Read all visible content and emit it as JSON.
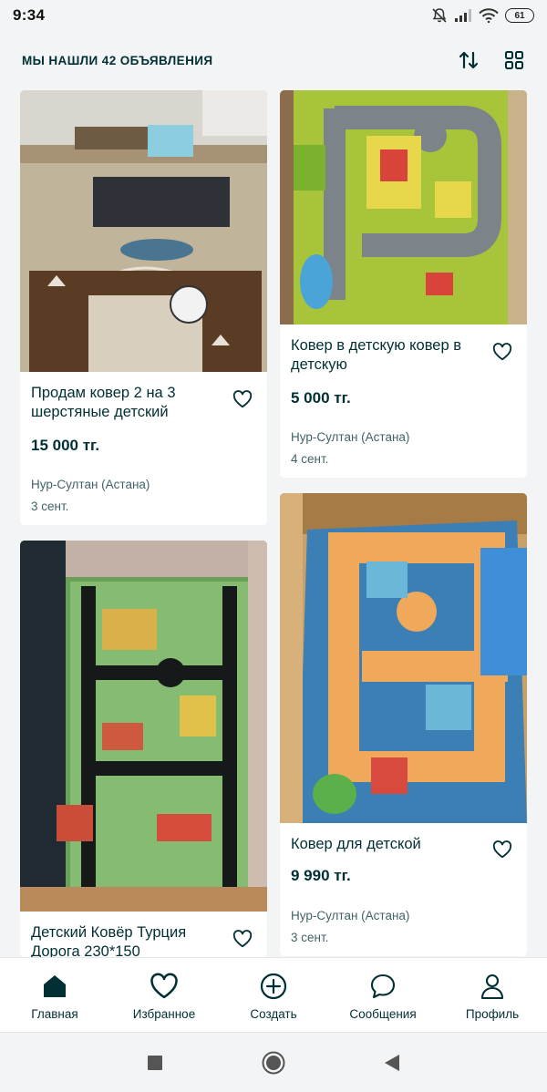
{
  "status_bar": {
    "time": "9:34",
    "battery": "61"
  },
  "header": {
    "results_title": "МЫ НАШЛИ 42 ОБЪЯВЛЕНИЯ"
  },
  "listings": [
    {
      "title": "Продам ковер 2 на 3 шерстяные детский",
      "price": "15 000 тг.",
      "location": "Нур-Султан (Астана)",
      "date": "3 сент."
    },
    {
      "title": "Ковер в детскую ковер в детскую",
      "price": "5 000 тг.",
      "location": "Нур-Султан (Астана)",
      "date": "4 сент."
    },
    {
      "title": "Детский Ковёр Турция Дорога 230*150",
      "price": "",
      "location": "",
      "date": ""
    },
    {
      "title": "Ковер для детской",
      "price": "9 990 тг.",
      "location": "Нур-Султан (Астана)",
      "date": "3 сент."
    }
  ],
  "bottom_nav": [
    {
      "label": "Главная",
      "icon": "home-icon",
      "active": true
    },
    {
      "label": "Избранное",
      "icon": "heart-icon"
    },
    {
      "label": "Создать",
      "icon": "plus-circle-icon"
    },
    {
      "label": "Сообщения",
      "icon": "chat-icon"
    },
    {
      "label": "Профиль",
      "icon": "user-icon"
    }
  ],
  "colors": {
    "primary_text": "#002f34",
    "secondary_text": "#406367",
    "background": "#f2f4f5"
  }
}
